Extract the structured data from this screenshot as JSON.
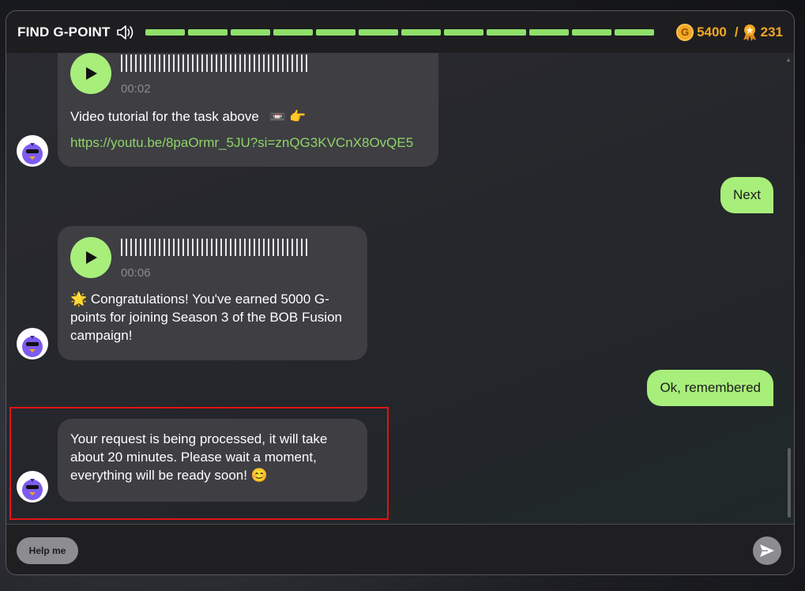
{
  "header": {
    "title": "FIND G-POINT",
    "progress_segments": 12,
    "points": "5400",
    "separator": "/",
    "rank": "231",
    "coin_letter": "G",
    "colors": {
      "progress": "#8fe06a",
      "points": "#f5a623"
    }
  },
  "messages": {
    "m1": {
      "duration": "00:02",
      "text": "Video tutorial for the task above",
      "emoji": "📼 👉",
      "link": "https://youtu.be/8paOrmr_5JU?si=znQG3KVCnX8OvQE5"
    },
    "m2": {
      "text": "Next"
    },
    "m3": {
      "duration": "00:06",
      "emoji": "🌟",
      "text": "Congratulations! You've earned 5000 G-points for joining Season 3 of the BOB Fusion campaign!"
    },
    "m4": {
      "text": "Ok, remembered"
    },
    "m5": {
      "text": "Your request is being processed, it will take about 20 minutes. Please wait a moment, everything will be ready soon!",
      "emoji": "😊"
    }
  },
  "footer": {
    "help_label": "Help me"
  },
  "icons": {
    "speaker": "speaker-icon",
    "coin": "g-coin-icon",
    "medal": "medal-icon",
    "play": "play-icon",
    "send": "send-icon",
    "avatar": "bird-avatar-icon"
  }
}
